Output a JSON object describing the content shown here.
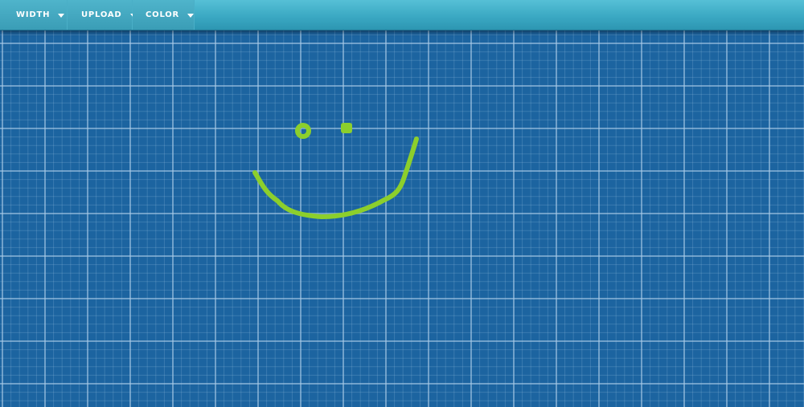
{
  "toolbar": {
    "menus": [
      {
        "label": "WIDTH"
      },
      {
        "label": "UPLOAD"
      },
      {
        "label": "COLOR"
      }
    ]
  },
  "canvas": {
    "background_color": "#1c64a0",
    "grid_line_color": "#a9cbe8",
    "brush_color": "#8ccf2c",
    "drawing": "smiley-face"
  }
}
